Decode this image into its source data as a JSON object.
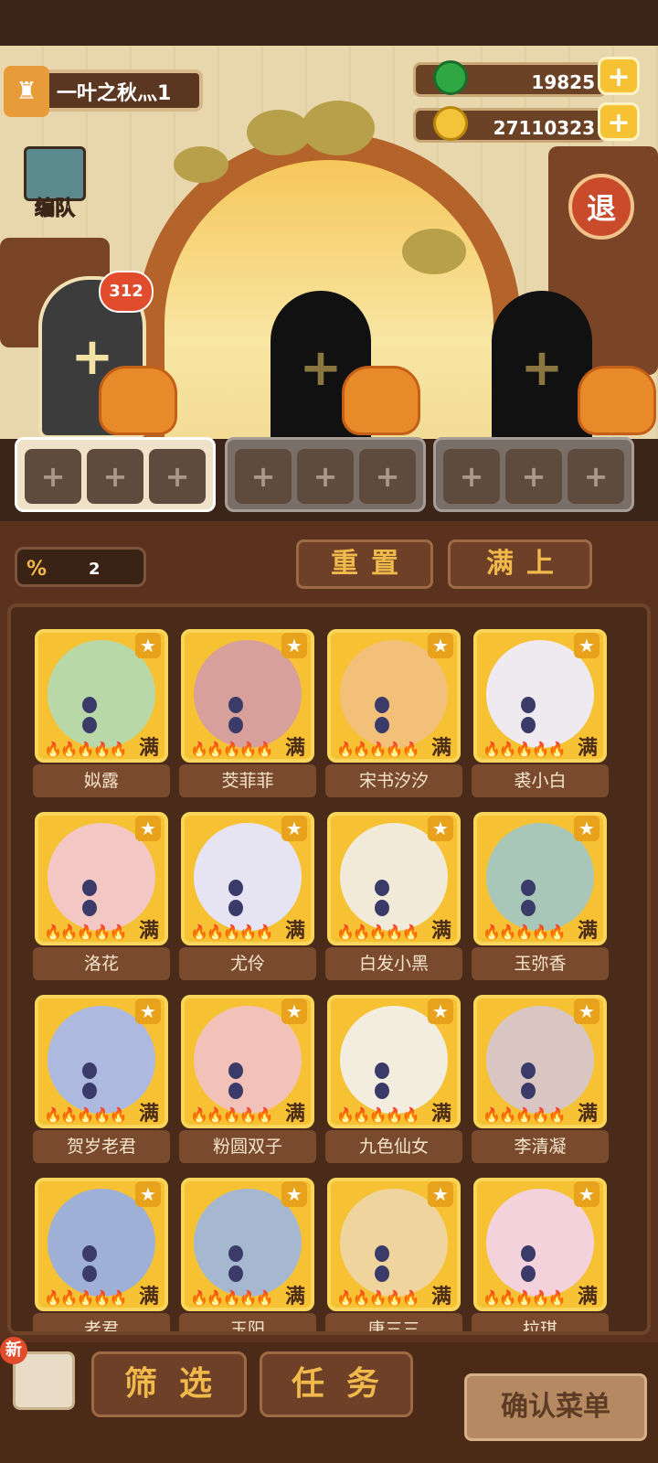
{
  "player": {
    "name": "一叶之秋灬1",
    "avatar_icon": "chef-avatar-icon"
  },
  "currency": {
    "jade": {
      "value": "19825",
      "icon": "green-jade-icon"
    },
    "coins": {
      "value": "27110323",
      "icon": "gold-coin-icon"
    },
    "plus": "+"
  },
  "team_button": {
    "label": "编队"
  },
  "exit_button": {
    "label": "退"
  },
  "notification_badge": "312",
  "slot_plus": "+",
  "filter": {
    "icon": "percent-icon",
    "count": "2"
  },
  "controls": {
    "reset": "重置",
    "fill": "满上"
  },
  "card_full": "满",
  "card_star": "★",
  "card_flames": "🔥🔥🔥🔥🔥",
  "characters": [
    {
      "name": "姒露",
      "color": "#b9d8a8"
    },
    {
      "name": "茭菲菲",
      "color": "#d8a09a"
    },
    {
      "name": "宋书汐汐",
      "color": "#f3c07a"
    },
    {
      "name": "裘小白",
      "color": "#efeaf0"
    },
    {
      "name": "洛花",
      "color": "#f3c7c4"
    },
    {
      "name": "尤伶",
      "color": "#e6e4f3"
    },
    {
      "name": "白发小黑",
      "color": "#f2ead9"
    },
    {
      "name": "玉弥香",
      "color": "#a9c7b8"
    },
    {
      "name": "贺岁老君",
      "color": "#aeb9df"
    },
    {
      "name": "粉圆双子",
      "color": "#f2c2b8"
    },
    {
      "name": "九色仙女",
      "color": "#f3ede0"
    },
    {
      "name": "李清凝",
      "color": "#d9c6c3"
    },
    {
      "name": "老君",
      "color": "#9fb0d6"
    },
    {
      "name": "玉阳",
      "color": "#a6b8d0"
    },
    {
      "name": "唐三三",
      "color": "#f0d49e"
    },
    {
      "name": "拉琪",
      "color": "#f3d2dc"
    }
  ],
  "bottom": {
    "new_tag": "新",
    "filter": "筛选",
    "tasks": "任务",
    "confirm": "确认菜单"
  }
}
